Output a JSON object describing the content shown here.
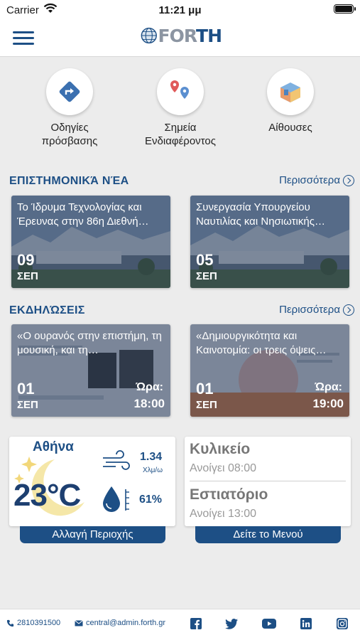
{
  "status_bar": {
    "carrier": "Carrier",
    "time": "11:21 μμ"
  },
  "header": {
    "logo_text_a": "FOR",
    "logo_text_b": "TH"
  },
  "quick_actions": [
    {
      "label_line1": "Οδηγίες",
      "label_line2": "πρόσβασης",
      "icon": "directions-icon"
    },
    {
      "label_line1": "Σημεία",
      "label_line2": "Ενδιαφέροντος",
      "icon": "map-pins-icon"
    },
    {
      "label_line1": "Αίθουσες",
      "label_line2": "",
      "icon": "room-icon"
    }
  ],
  "news": {
    "title": "ΕΠΙΣΤΗΜΟΝΙΚΆ ΝΈΑ",
    "more": "Περισσότερα",
    "items": [
      {
        "title": "Το Ίδρυμα Τεχνολογίας και Έρευνας στην 86η Διεθνή…",
        "day": "09",
        "month": "ΣΕΠ"
      },
      {
        "title": "Συνεργασία Υπουργείου Ναυτιλίας και Νησιωτικής…",
        "day": "05",
        "month": "ΣΕΠ"
      }
    ]
  },
  "events": {
    "title": "ΕΚΔΗΛΏΣΕΙΣ",
    "more": "Περισσότερα",
    "items": [
      {
        "title": "«Ο ουρανός στην επιστήμη, τη μουσική, και τη…",
        "day": "01",
        "month": "ΣΕΠ",
        "hour_label": "Ώρα:",
        "hour": "18:00"
      },
      {
        "title": "«Δημιουργικότητα και Καινοτομία: οι τρεις όψεις…",
        "day": "01",
        "month": "ΣΕΠ",
        "hour_label": "Ώρα:",
        "hour": "19:00"
      }
    ]
  },
  "weather": {
    "city": "Αθήνα",
    "temperature": "23°C",
    "wind_speed": "1.34",
    "wind_unit": "Χλμ/ω",
    "humidity": "61%",
    "button": "Αλλαγή Περιοχής"
  },
  "venues": {
    "canteen_title": "Κυλικείο",
    "canteen_hours": "Ανοίγει 08:00",
    "restaurant_title": "Εστιατόριο",
    "restaurant_hours": "Ανοίγει 13:00",
    "button": "Δείτε το Μενού"
  },
  "footer": {
    "phone": "2810391500",
    "email": "central@admin.forth.gr",
    "social": [
      "facebook-icon",
      "twitter-icon",
      "youtube-icon",
      "linkedin-icon",
      "instagram-icon"
    ]
  },
  "colors": {
    "brand": "#1d4f85",
    "logo_grey": "#8c95a2",
    "background": "#ececec"
  }
}
